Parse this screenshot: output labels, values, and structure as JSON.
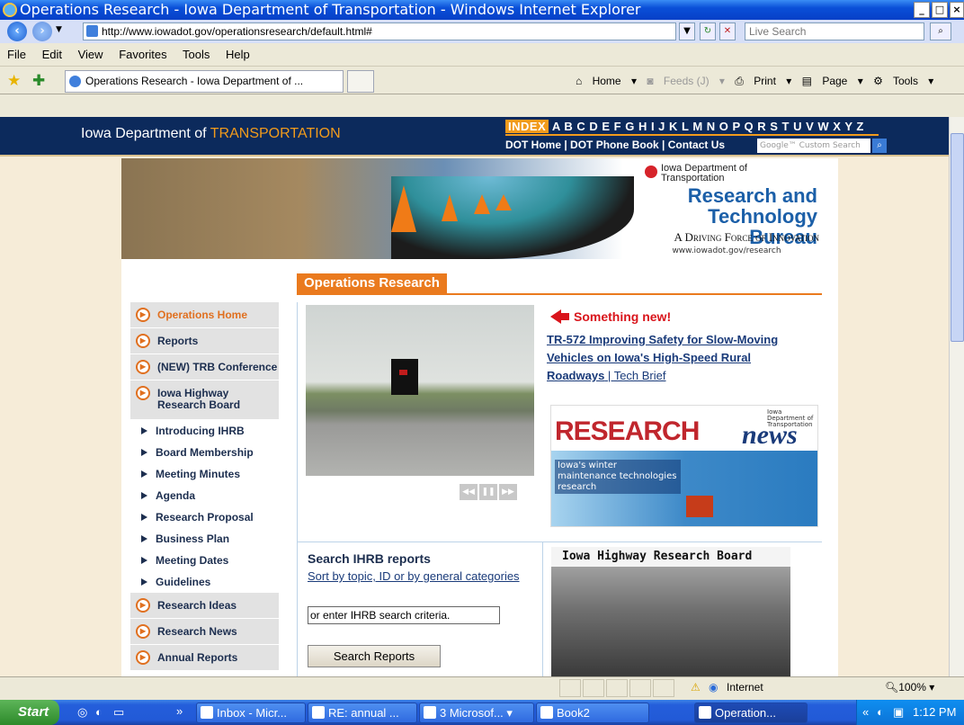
{
  "window": {
    "title": "Operations Research - Iowa Department of Transportation - Windows Internet Explorer"
  },
  "address": {
    "url": "http://www.iowadot.gov/operationsresearch/default.html#",
    "search_placeholder": "Live Search"
  },
  "menu": [
    "File",
    "Edit",
    "View",
    "Favorites",
    "Tools",
    "Help"
  ],
  "tab": {
    "label": "Operations Research - Iowa Department of ..."
  },
  "command_bar": {
    "home": "Home",
    "feeds": "Feeds (J)",
    "print": "Print",
    "page": "Page",
    "tools": "Tools"
  },
  "site_header": {
    "name_prefix": "Iowa Department of",
    "name_highlight": "TRANSPORTATION",
    "index_label": "INDEX",
    "letters": "A B C D E F G H I J K L M N O P Q R S T U V W X Y Z",
    "links": "DOT Home | DOT Phone Book | Contact Us",
    "search_placeholder": "Google™ Custom Search"
  },
  "banner": {
    "agency": "Iowa Department of Transportation",
    "bureau_line1": "Research and",
    "bureau_line2": "Technology Bureau",
    "slogan": "A Driving Force of Innovation",
    "url": "www.iowadot.gov/research"
  },
  "section_title": "Operations Research",
  "sidebar": {
    "items_top": [
      {
        "label": "Operations Home",
        "active": true
      },
      {
        "label": "Reports"
      },
      {
        "label": "(NEW) TRB Conference"
      }
    ],
    "ihrb_line1": "Iowa Highway",
    "ihrb_line2": "Research Board",
    "subitems": [
      "Introducing IHRB",
      "Board Membership",
      "Meeting Minutes",
      "Agenda",
      "Research Proposal",
      "Business Plan",
      "Meeting Dates",
      "Guidelines"
    ],
    "items_bottom": [
      {
        "label": "Research Ideas"
      },
      {
        "label": "Research News"
      },
      {
        "label": "Annual Reports"
      }
    ]
  },
  "news": {
    "something_new": "Something new!",
    "headline": "TR-572 Improving Safety for Slow-Moving Vehicles on Iowa's High-Speed Rural Roadways",
    "separator": " | ",
    "tech_brief": "Tech Brief"
  },
  "research_news": {
    "word1": "RESEARCH",
    "word2": "news",
    "agency": "Iowa Department of Transportation",
    "caption": "Iowa's winter maintenance technologies research"
  },
  "search": {
    "title": "Search IHRB reports",
    "sort_link": "Sort by topic, ID or by general categories",
    "input_value": "or enter IHRB search criteria.",
    "button": "Search Reports"
  },
  "ihrb_box": {
    "title": "Iowa Highway Research Board"
  },
  "statusbar": {
    "zone": "Internet",
    "zoom": "100%"
  },
  "taskbar": {
    "start": "Start",
    "buttons": [
      "Inbox - Micr...",
      "RE: annual ...",
      "3 Microsof...",
      "Book2",
      "Operation..."
    ],
    "time": "1:12 PM"
  },
  "colors": {
    "dot_navy": "#0c2a5c",
    "accent_orange": "#ea7a1e",
    "link_blue": "#1a3b7a",
    "alert_red": "#d9141b"
  }
}
